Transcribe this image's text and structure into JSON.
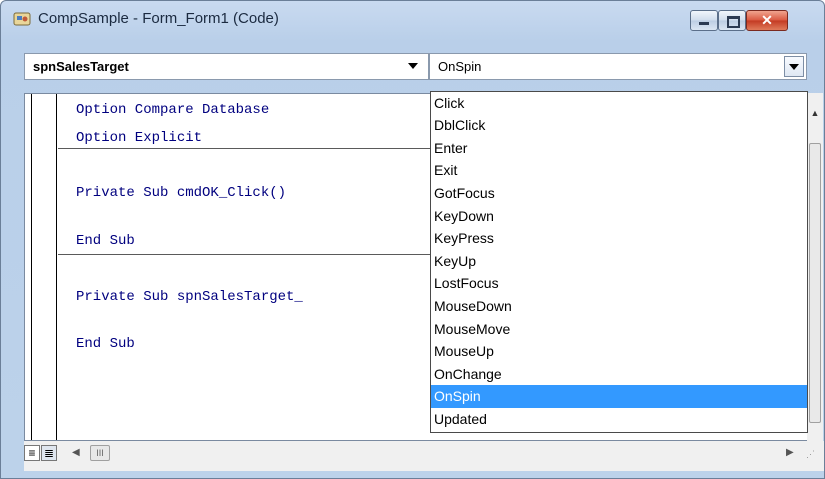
{
  "window": {
    "title": "CompSample - Form_Form1 (Code)",
    "controls": {
      "minimize": "–",
      "maximize": "□",
      "close": "✕"
    }
  },
  "object_combo": {
    "value": "spnSalesTarget"
  },
  "procedure_combo": {
    "value": "OnSpin",
    "options": [
      "Click",
      "DblClick",
      "Enter",
      "Exit",
      "GotFocus",
      "KeyDown",
      "KeyPress",
      "KeyUp",
      "LostFocus",
      "MouseDown",
      "MouseMove",
      "MouseUp",
      "OnChange",
      "OnSpin",
      "Updated"
    ],
    "selected": "OnSpin"
  },
  "code": {
    "lines": [
      "Option Compare Database",
      "Option Explicit",
      "Private Sub cmdOK_Click()",
      "End Sub",
      "Private Sub spnSalesTarget_"
    ],
    "end_sub": "End Sub"
  },
  "scrollbar": {
    "h_thumb_glyph": "III"
  },
  "colors": {
    "keyword": "#00007f",
    "selection": "#3399ff",
    "frame": "#bcd2ea"
  },
  "icons": [
    "app-icon",
    "minimize-icon",
    "maximize-icon",
    "close-icon",
    "chevron-down-icon",
    "procedure-view-icon",
    "full-module-view-icon"
  ]
}
